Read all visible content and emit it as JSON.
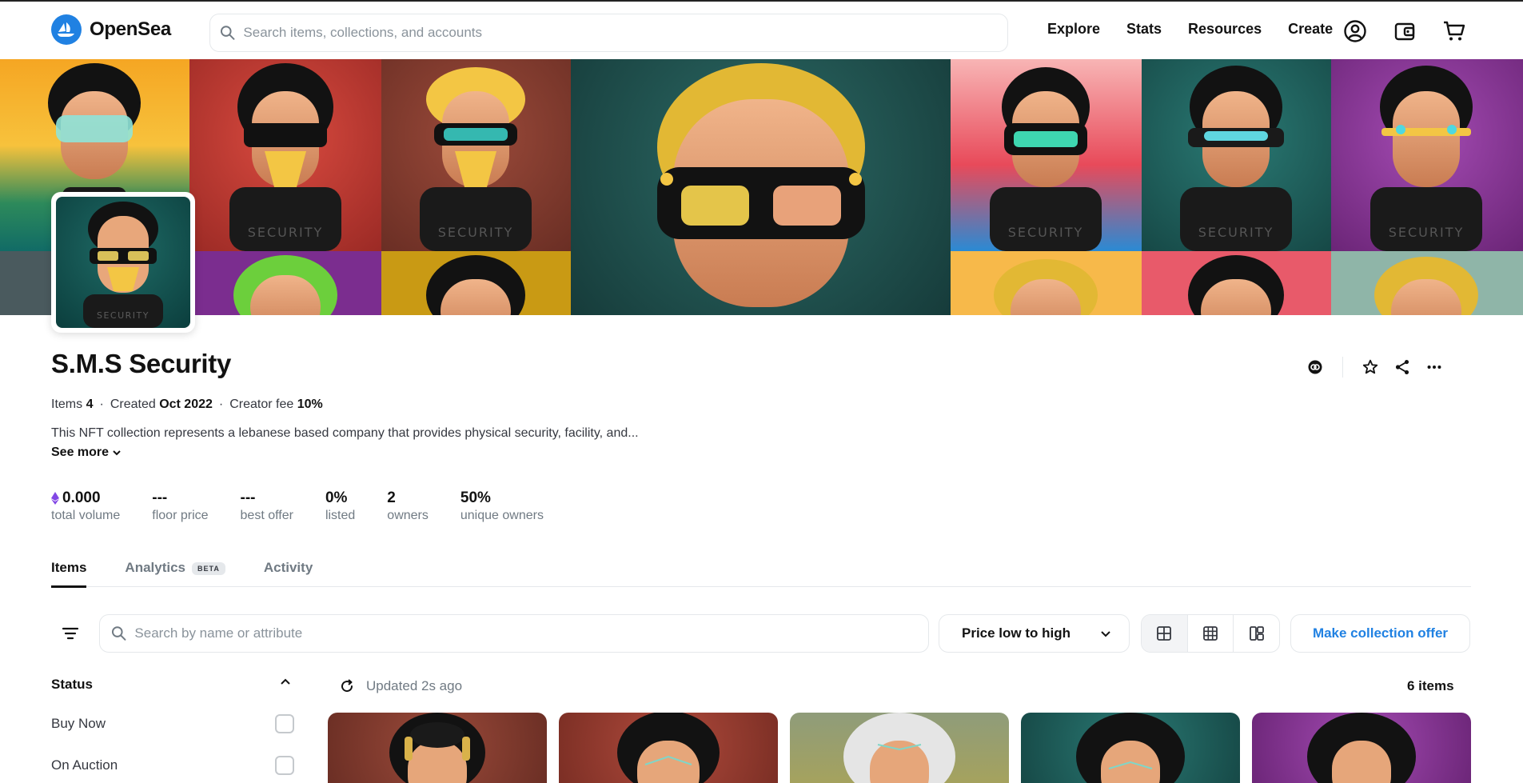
{
  "header": {
    "brand": "OpenSea",
    "search_placeholder": "Search items, collections, and accounts",
    "nav": [
      "Explore",
      "Stats",
      "Resources",
      "Create"
    ]
  },
  "collection": {
    "name": "S.M.S Security",
    "items_label": "Items",
    "items_count": "4",
    "created_label": "Created",
    "created_value": "Oct 2022",
    "fee_label": "Creator fee",
    "fee_value": "10%",
    "description": "This NFT collection represents a lebanese based company that provides physical security, facility, and...",
    "see_more": "See more"
  },
  "stats": [
    {
      "value": "0.000",
      "label": "total volume"
    },
    {
      "value": "---",
      "label": "floor price"
    },
    {
      "value": "---",
      "label": "best offer"
    },
    {
      "value": "0%",
      "label": "listed"
    },
    {
      "value": "2",
      "label": "owners"
    },
    {
      "value": "50%",
      "label": "unique owners"
    }
  ],
  "tabs": {
    "items": "Items",
    "analytics": "Analytics",
    "beta": "BETA",
    "activity": "Activity"
  },
  "toolbar": {
    "search_placeholder": "Search by name or attribute",
    "sort": "Price low to high",
    "offer": "Make collection offer"
  },
  "sidebar": {
    "status": "Status",
    "buy_now": "Buy Now",
    "on_auction": "On Auction"
  },
  "results": {
    "updated": "Updated 2s ago",
    "count": "6 items"
  },
  "colors": {
    "accent": "#2081e2",
    "text": "#121212",
    "muted": "#707a83",
    "border": "#e5e8eb"
  }
}
